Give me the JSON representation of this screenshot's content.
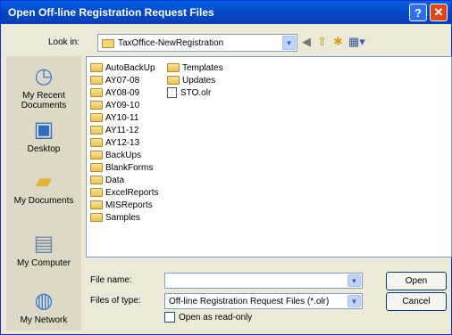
{
  "title": "Open Off-line Registration Request Files",
  "title_buttons": {
    "help": "?",
    "close": "✕"
  },
  "look_in": {
    "label": "Look in:",
    "value": "TaxOffice-NewRegistration"
  },
  "toolbar_icons": [
    "back-icon",
    "up-folder-icon",
    "new-folder-icon",
    "views-menu-icon"
  ],
  "places": [
    {
      "label": "My Recent Documents",
      "icon": "recent-documents-icon"
    },
    {
      "label": "Desktop",
      "icon": "desktop-icon"
    },
    {
      "label": "My Documents",
      "icon": "my-documents-icon"
    },
    {
      "label": "My Computer",
      "icon": "my-computer-icon"
    },
    {
      "label": "My Network",
      "icon": "my-network-icon"
    }
  ],
  "files": {
    "column1": [
      "AutoBackUp",
      "AY07-08",
      "AY08-09",
      "AY09-10",
      "AY10-11",
      "AY11-12",
      "AY12-13",
      "BackUps",
      "BlankForms",
      "Data",
      "ExcelReports",
      "MISReports",
      "Samples"
    ],
    "column2": [
      "Templates",
      "Updates"
    ],
    "column2_files": [
      "STO.olr"
    ]
  },
  "file_name": {
    "label": "File name:",
    "value": ""
  },
  "file_type": {
    "label": "Files of type:",
    "value": "Off-line Registration Request Files (*.olr)"
  },
  "read_only": {
    "label": "Open as read-only",
    "checked": false
  },
  "buttons": {
    "open": "Open",
    "cancel": "Cancel"
  }
}
